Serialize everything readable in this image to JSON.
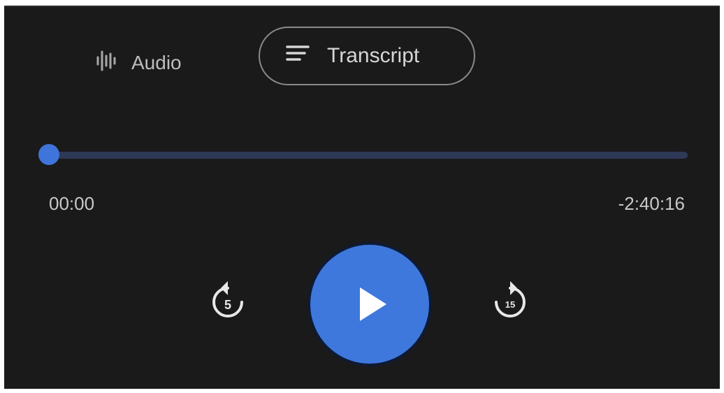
{
  "tabs": {
    "audio": {
      "label": "Audio",
      "icon": "audio-waveform-icon",
      "selected": false
    },
    "transcript": {
      "label": "Transcript",
      "icon": "transcript-lines-icon",
      "selected": true
    }
  },
  "player": {
    "elapsed": "00:00",
    "remaining": "-2:40:16",
    "progress_fraction": 0.0,
    "skip_back": {
      "icon": "replay-5-icon",
      "seconds": "5"
    },
    "skip_forward": {
      "icon": "forward-15-icon",
      "seconds": "15"
    },
    "play": {
      "icon": "play-icon",
      "state": "paused"
    }
  },
  "colors": {
    "background": "#1a1a1b",
    "accent": "#3f74da",
    "track": "#2e3957",
    "text": "#c8c8c8"
  }
}
